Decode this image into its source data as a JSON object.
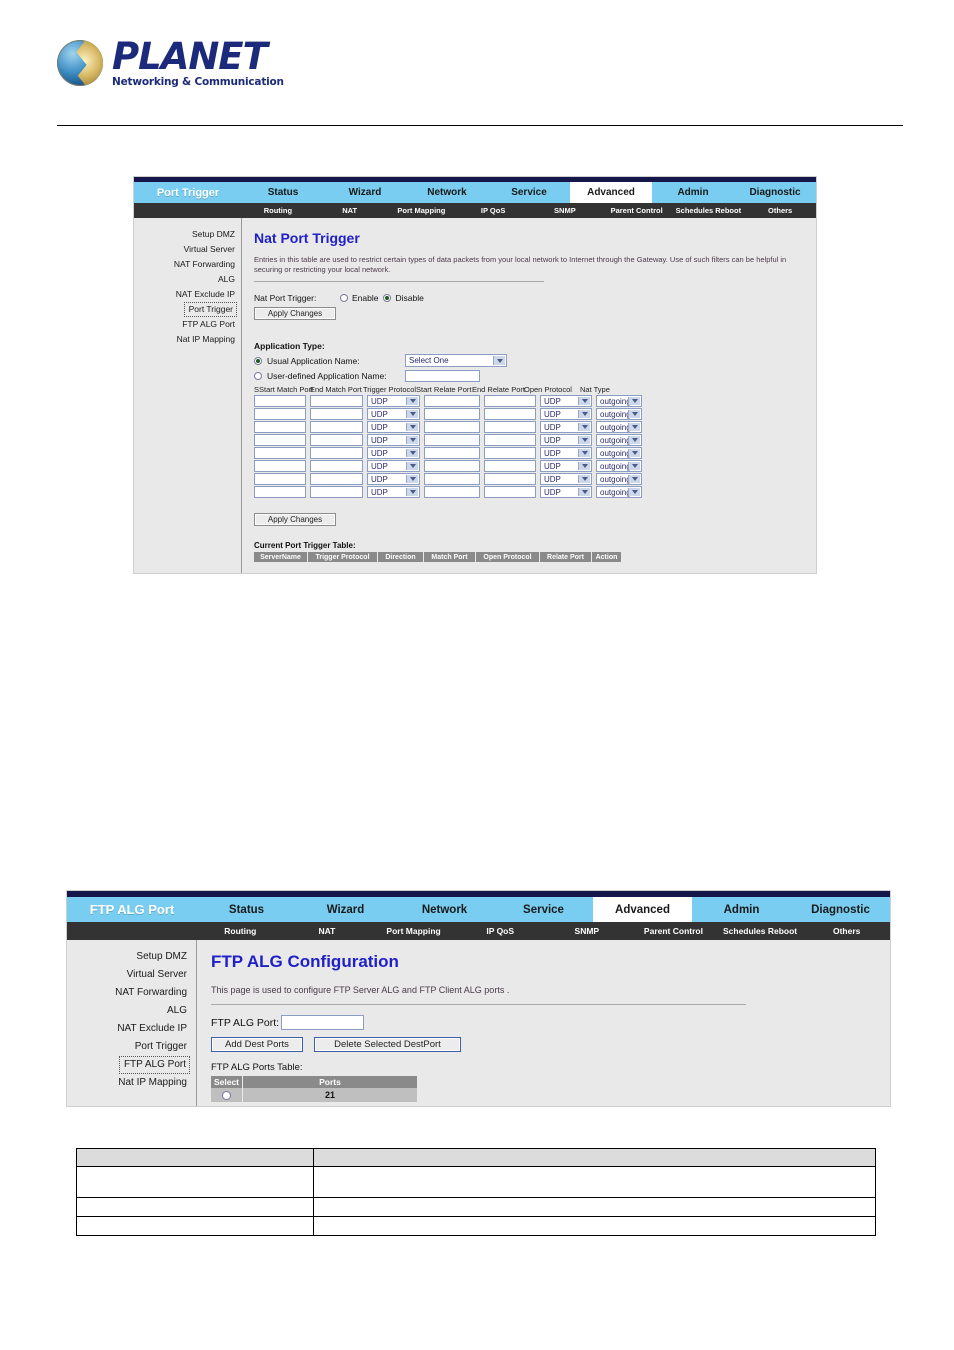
{
  "document": {
    "brand": {
      "word": "PLANET",
      "tagline": "Networking & Communication",
      "logo_icon": "planet-globe-logo"
    }
  },
  "screenshot_port_trigger": {
    "nav": {
      "brand": "Port Trigger",
      "items": [
        {
          "label": "Status",
          "active": false
        },
        {
          "label": "Wizard",
          "active": false
        },
        {
          "label": "Network",
          "active": false
        },
        {
          "label": "Service",
          "active": false
        },
        {
          "label": "Advanced",
          "active": true
        },
        {
          "label": "Admin",
          "active": false
        },
        {
          "label": "Diagnostic",
          "active": false
        }
      ],
      "subitems": [
        {
          "label": "Routing"
        },
        {
          "label": "NAT"
        },
        {
          "label": "Port Mapping"
        },
        {
          "label": "IP QoS"
        },
        {
          "label": "SNMP"
        },
        {
          "label": "Parent Control"
        },
        {
          "label": "Schedules Reboot"
        },
        {
          "label": "Others"
        }
      ]
    },
    "sidebar": {
      "items": [
        {
          "label": "Setup DMZ",
          "selected": false
        },
        {
          "label": "Virtual Server",
          "selected": false
        },
        {
          "label": "NAT Forwarding",
          "selected": false
        },
        {
          "label": "ALG",
          "selected": false
        },
        {
          "label": "NAT Exclude IP",
          "selected": false
        },
        {
          "label": "Port Trigger",
          "selected": true
        },
        {
          "label": "FTP ALG Port",
          "selected": false
        },
        {
          "label": "Nat IP Mapping",
          "selected": false
        }
      ]
    },
    "content": {
      "title": "Nat Port Trigger",
      "description": "Entries in this table are used to restrict certain types of data packets from your local network to Internet through the Gateway. Use of such filters can be helpful in securing or restricting your local network.",
      "trigger_label": "Nat Port Trigger:",
      "radio_enable": "Enable",
      "radio_disable": "Disable",
      "radio_selected": "Disable",
      "apply_top": "Apply Changes",
      "app_type_label": "Application Type:",
      "usual_app_label": "Usual Application Name:",
      "usual_app_selected": true,
      "usual_app_value": "Select One",
      "user_defined_label": "User-defined Application Name:",
      "user_defined_selected": false,
      "user_defined_value": "",
      "grid_headers": [
        "SStart Match Port",
        "End Match Port",
        "Trigger Protocol",
        "Start Relate Port",
        "End Relate Port",
        "Open Protocol",
        "Nat Type"
      ],
      "grid_rows": [
        {
          "start_match": "",
          "end_match": "",
          "trigger_protocol": "UDP",
          "start_relate": "",
          "end_relate": "",
          "open_protocol": "UDP",
          "nat_type": "outgoing"
        },
        {
          "start_match": "",
          "end_match": "",
          "trigger_protocol": "UDP",
          "start_relate": "",
          "end_relate": "",
          "open_protocol": "UDP",
          "nat_type": "outgoing"
        },
        {
          "start_match": "",
          "end_match": "",
          "trigger_protocol": "UDP",
          "start_relate": "",
          "end_relate": "",
          "open_protocol": "UDP",
          "nat_type": "outgoing"
        },
        {
          "start_match": "",
          "end_match": "",
          "trigger_protocol": "UDP",
          "start_relate": "",
          "end_relate": "",
          "open_protocol": "UDP",
          "nat_type": "outgoing"
        },
        {
          "start_match": "",
          "end_match": "",
          "trigger_protocol": "UDP",
          "start_relate": "",
          "end_relate": "",
          "open_protocol": "UDP",
          "nat_type": "outgoing"
        },
        {
          "start_match": "",
          "end_match": "",
          "trigger_protocol": "UDP",
          "start_relate": "",
          "end_relate": "",
          "open_protocol": "UDP",
          "nat_type": "outgoing"
        },
        {
          "start_match": "",
          "end_match": "",
          "trigger_protocol": "UDP",
          "start_relate": "",
          "end_relate": "",
          "open_protocol": "UDP",
          "nat_type": "outgoing"
        },
        {
          "start_match": "",
          "end_match": "",
          "trigger_protocol": "UDP",
          "start_relate": "",
          "end_relate": "",
          "open_protocol": "UDP",
          "nat_type": "outgoing"
        }
      ],
      "apply_bottom": "Apply Changes",
      "table_caption": "Current Port Trigger Table:",
      "table_headers": [
        "ServerName",
        "Trigger Protocol",
        "Direction",
        "Match Port",
        "Open Protocol",
        "Relate Port",
        "Action"
      ],
      "table_rows": []
    }
  },
  "screenshot_ftp_alg": {
    "nav": {
      "brand": "FTP ALG Port",
      "items": [
        {
          "label": "Status",
          "active": false
        },
        {
          "label": "Wizard",
          "active": false
        },
        {
          "label": "Network",
          "active": false
        },
        {
          "label": "Service",
          "active": false
        },
        {
          "label": "Advanced",
          "active": true
        },
        {
          "label": "Admin",
          "active": false
        },
        {
          "label": "Diagnostic",
          "active": false
        }
      ],
      "subitems": [
        {
          "label": "Routing"
        },
        {
          "label": "NAT"
        },
        {
          "label": "Port Mapping"
        },
        {
          "label": "IP QoS"
        },
        {
          "label": "SNMP"
        },
        {
          "label": "Parent Control"
        },
        {
          "label": "Schedules Reboot"
        },
        {
          "label": "Others"
        }
      ]
    },
    "sidebar": {
      "items": [
        {
          "label": "Setup DMZ",
          "selected": false
        },
        {
          "label": "Virtual Server",
          "selected": false
        },
        {
          "label": "NAT Forwarding",
          "selected": false
        },
        {
          "label": "ALG",
          "selected": false
        },
        {
          "label": "NAT Exclude IP",
          "selected": false
        },
        {
          "label": "Port Trigger",
          "selected": false
        },
        {
          "label": "FTP ALG Port",
          "selected": true
        },
        {
          "label": "Nat IP Mapping",
          "selected": false
        }
      ]
    },
    "content": {
      "title": "FTP ALG Configuration",
      "description": "This page is used to configure FTP Server ALG and FTP Client ALG ports .",
      "port_label": "FTP ALG Port:",
      "port_value": "",
      "add_button": "Add Dest Ports",
      "delete_button": "Delete Selected DestPort",
      "table_caption": "FTP ALG Ports Table:",
      "table_headers": [
        "Select",
        "Ports"
      ],
      "table_rows": [
        {
          "select": "",
          "ports": "21"
        }
      ]
    }
  },
  "bottom_table": {
    "rows": [
      {
        "cells": [
          "",
          ""
        ],
        "header": true
      },
      {
        "cells": [
          "",
          ""
        ],
        "header": false
      },
      {
        "cells": [
          "",
          ""
        ],
        "header": false
      },
      {
        "cells": [
          "",
          ""
        ],
        "header": false
      }
    ]
  }
}
